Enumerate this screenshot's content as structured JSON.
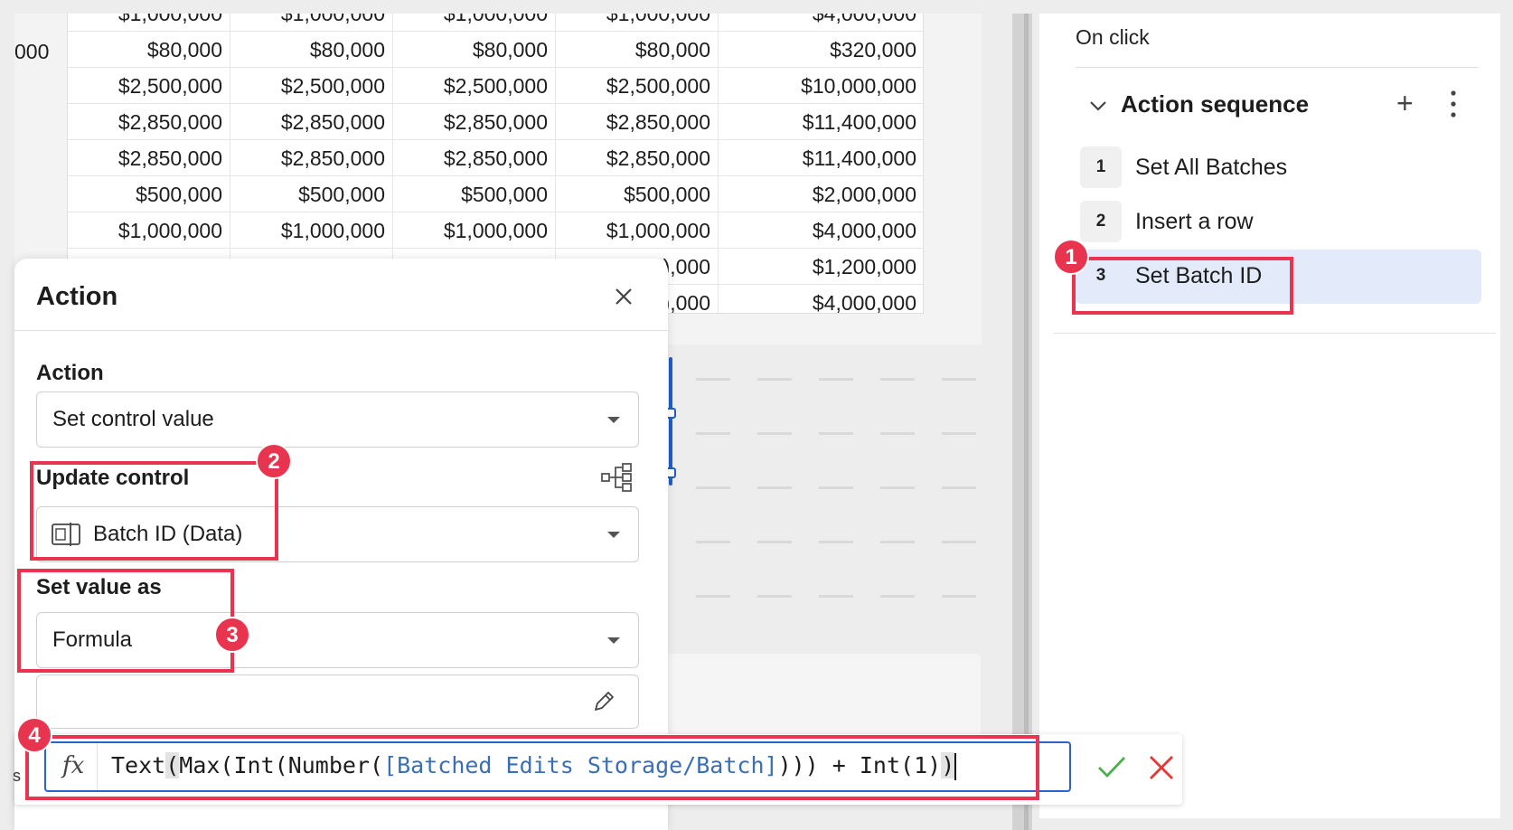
{
  "table": {
    "row_label": "000",
    "rows": [
      [
        "$1,000,000",
        "$1,000,000",
        "$1,000,000",
        "$1,000,000",
        "$4,000,000"
      ],
      [
        "$80,000",
        "$80,000",
        "$80,000",
        "$80,000",
        "$320,000"
      ],
      [
        "$2,500,000",
        "$2,500,000",
        "$2,500,000",
        "$2,500,000",
        "$10,000,000"
      ],
      [
        "$2,850,000",
        "$2,850,000",
        "$2,850,000",
        "$2,850,000",
        "$11,400,000"
      ],
      [
        "$2,850,000",
        "$2,850,000",
        "$2,850,000",
        "$2,850,000",
        "$11,400,000"
      ],
      [
        "$500,000",
        "$500,000",
        "$500,000",
        "$500,000",
        "$2,000,000"
      ],
      [
        "$1,000,000",
        "$1,000,000",
        "$1,000,000",
        "$1,000,000",
        "$4,000,000"
      ],
      [
        "",
        "",
        "",
        "),000",
        "$1,200,000"
      ],
      [
        "",
        "",
        "",
        "),000",
        "$4,000,000"
      ]
    ]
  },
  "right_panel": {
    "on_click": "On click",
    "sequence_title": "Action sequence",
    "add_symbol": "+",
    "items": [
      {
        "num": "1",
        "label": "Set All Batches",
        "selected": false
      },
      {
        "num": "2",
        "label": "Insert a row",
        "selected": false
      },
      {
        "num": "3",
        "label": "Set Batch ID",
        "selected": true
      }
    ]
  },
  "dialog": {
    "title": "Action",
    "action_label": "Action",
    "action_value": "Set control value",
    "update_control_label": "Update control",
    "update_control_value": "Batch ID (Data)",
    "set_value_label": "Set value as",
    "set_value_value": "Formula"
  },
  "formula_bar": {
    "fx_label": "fx",
    "left_fragment": "s",
    "parts": {
      "p1": "Text",
      "p2": "(",
      "p3": "Max(Int(Number(",
      "p4": "[Batched Edits Storage/Batch]",
      "p5": "))) + Int(1)",
      "p6": ")"
    }
  },
  "callouts": [
    "1",
    "2",
    "3",
    "4"
  ],
  "colors": {
    "accent": "#2e61c9",
    "callout": "#e8344e",
    "selected_row": "#e3ebfa",
    "confirm": "#4caf50",
    "cancel": "#e53935",
    "reference": "#3a6fb5"
  },
  "icons": {
    "close": "close-icon",
    "chevron": "chevron-down-icon",
    "more": "more-vertical-icon",
    "tree": "hierarchy-icon",
    "control": "text-control-icon",
    "pencil": "pencil-icon",
    "confirm": "checkmark-icon",
    "cancel": "x-icon"
  }
}
